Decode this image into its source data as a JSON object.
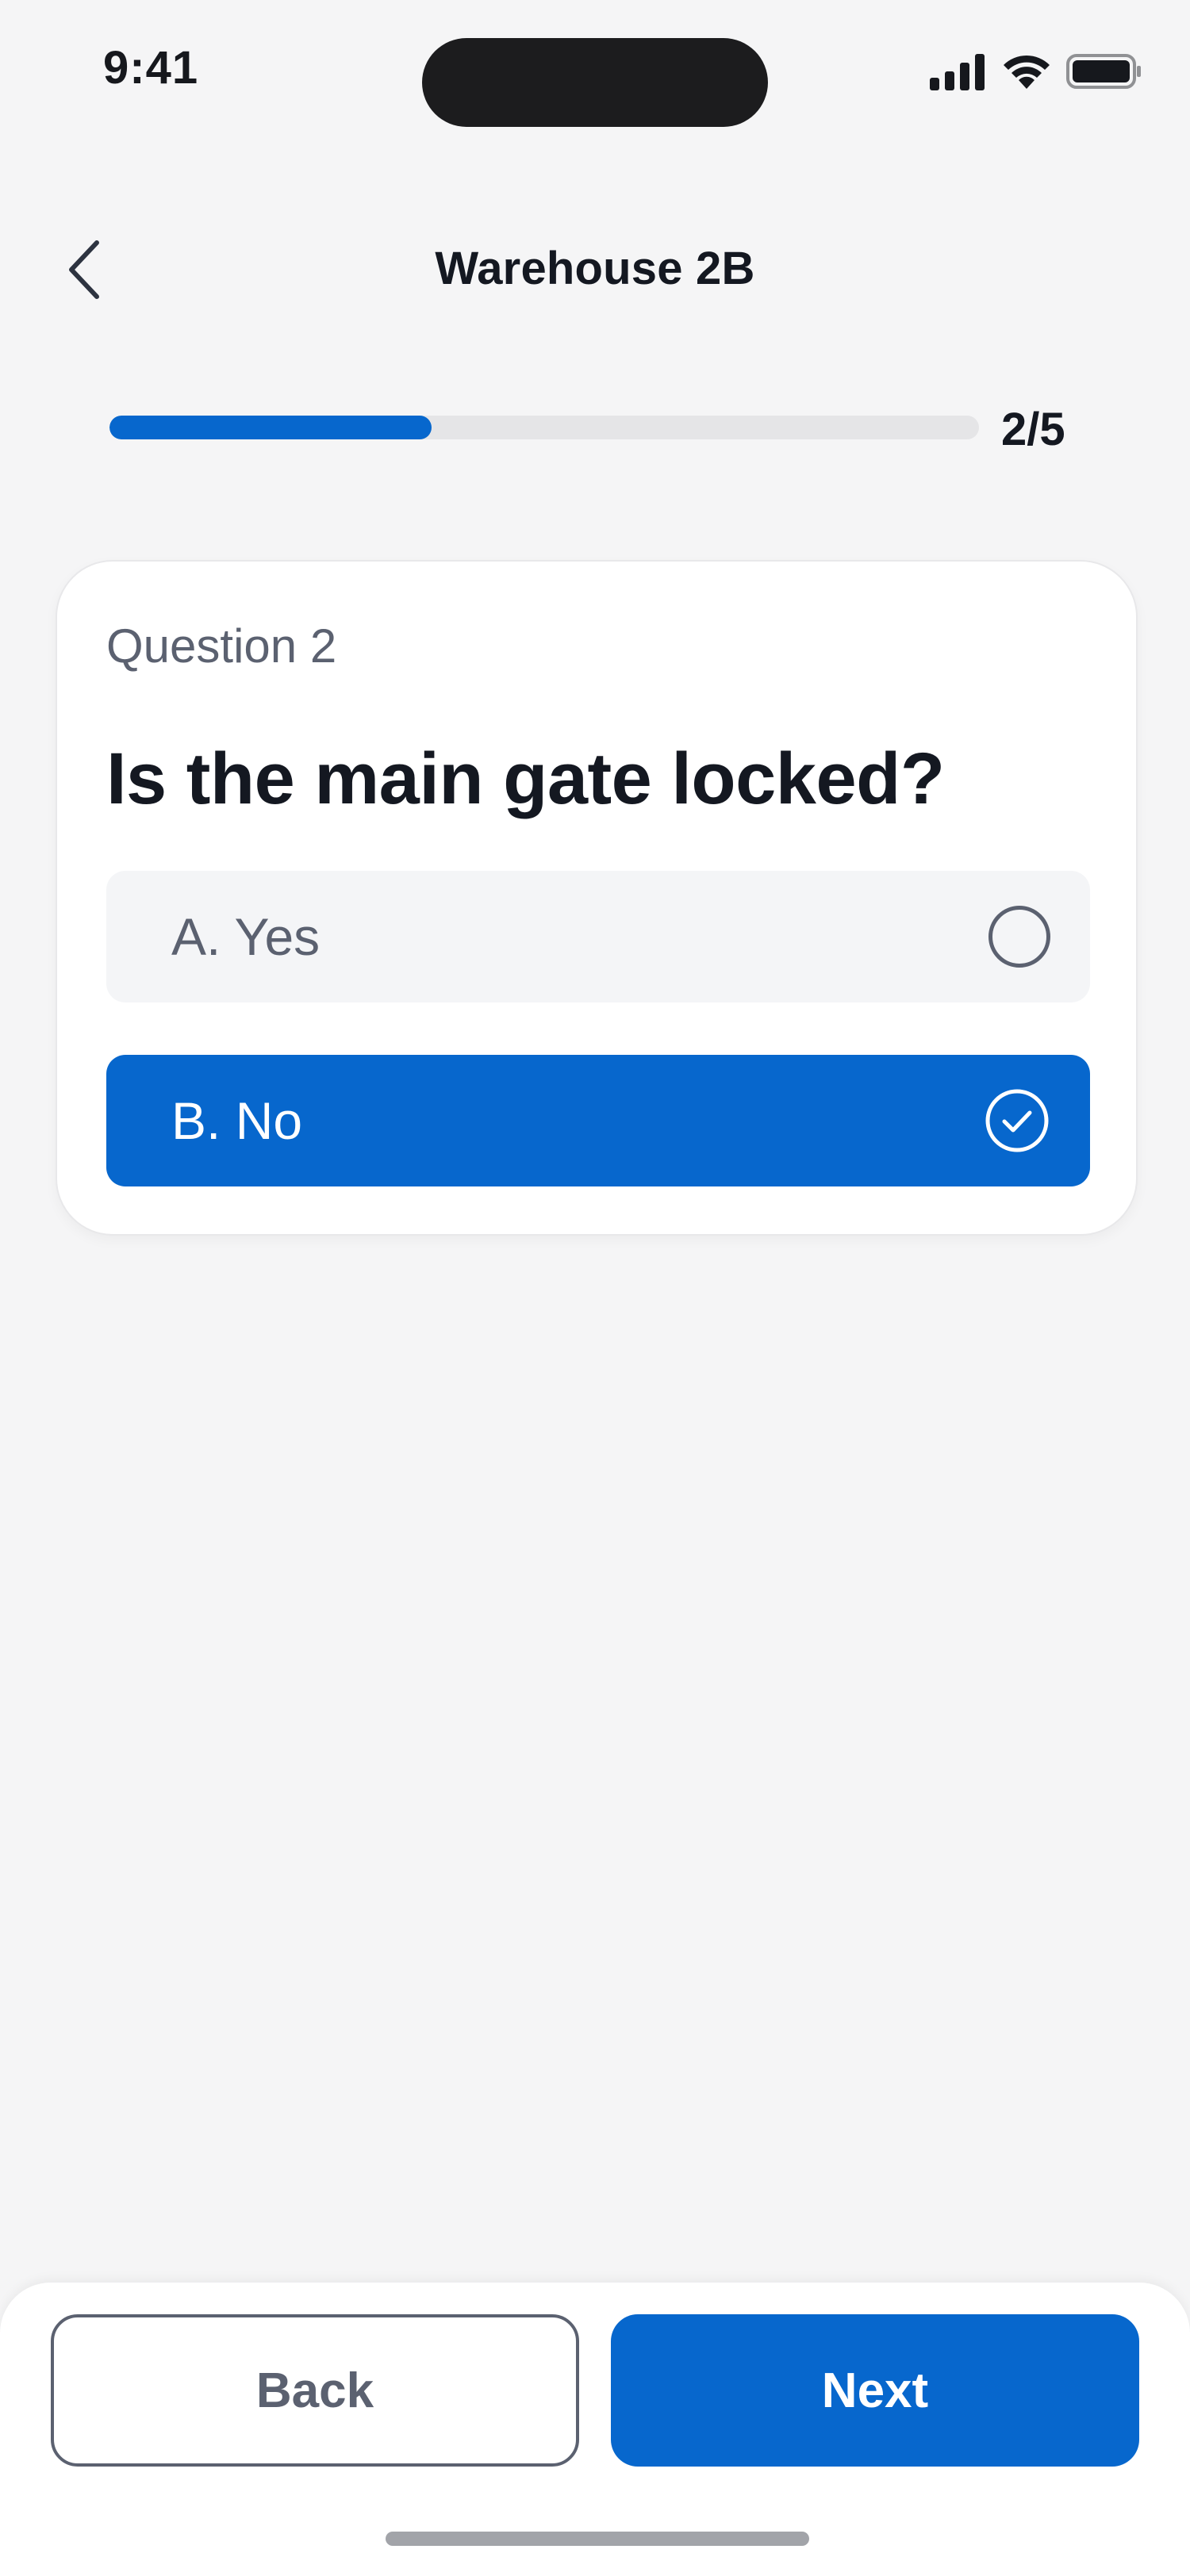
{
  "status_bar": {
    "time": "9:41",
    "icons": [
      "cellular-signal-icon",
      "wifi-icon",
      "battery-icon"
    ]
  },
  "header": {
    "back_icon": "chevron-left-icon",
    "title": "Warehouse 2B"
  },
  "progress": {
    "current": 2,
    "total": 5,
    "fraction": 0.37,
    "label": "2/5"
  },
  "question": {
    "number_label": "Question 2",
    "text": "Is the main gate locked?",
    "options": [
      {
        "label": "A. Yes",
        "selected": false,
        "icon": "radio-unchecked-icon"
      },
      {
        "label": "B. No",
        "selected": true,
        "icon": "check-circle-icon"
      }
    ]
  },
  "footer": {
    "back_label": "Back",
    "next_label": "Next"
  },
  "colors": {
    "accent": "#0767cd",
    "background": "#f5f5f6",
    "text_primary": "#141821",
    "text_secondary": "#5b6170"
  }
}
